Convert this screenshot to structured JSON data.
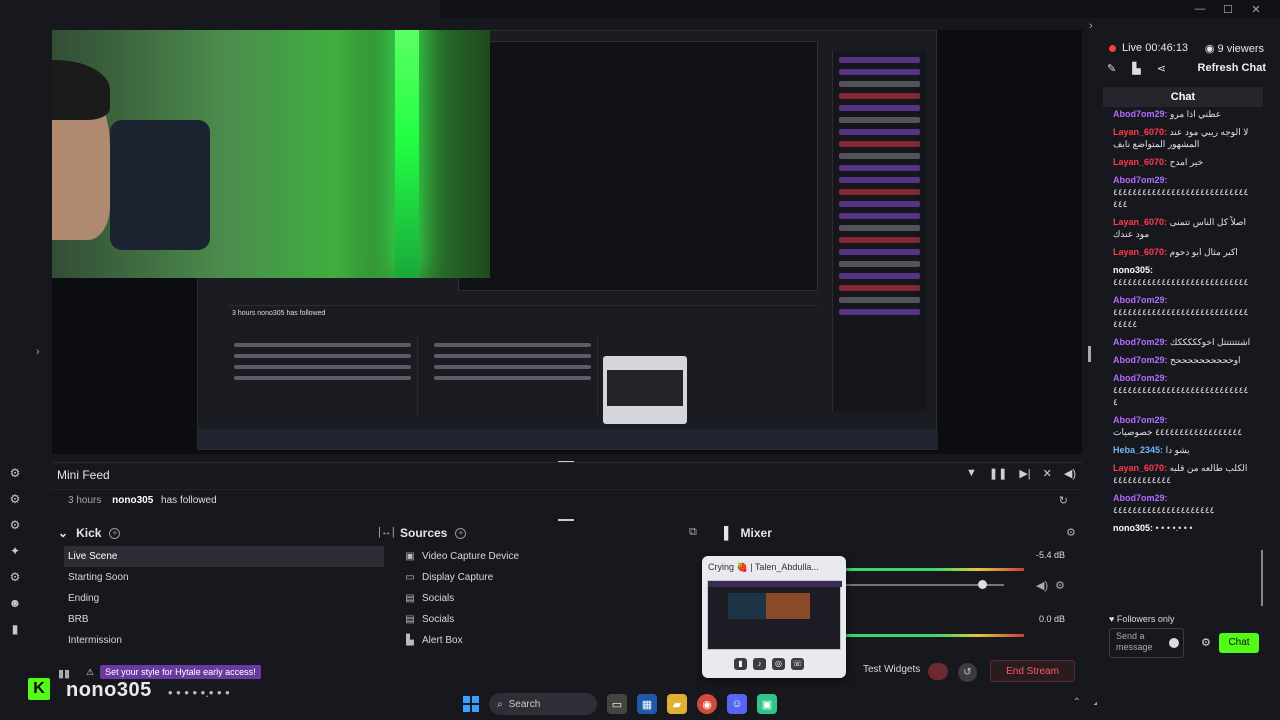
{
  "window": {
    "controls": [
      "—",
      "☐",
      "✕"
    ]
  },
  "preview": {
    "nested_feed_text": "3 hours  nono305  has followed"
  },
  "mini_feed": {
    "title": "Mini Feed",
    "entry": {
      "time": "3 hours",
      "user": "nono305",
      "action": "has followed"
    }
  },
  "scenes": {
    "title": "Kick",
    "items": [
      "Live Scene",
      "Starting Soon",
      "Ending",
      "BRB",
      "Intermission"
    ]
  },
  "sources": {
    "title": "Sources",
    "items": [
      {
        "label": "Video Capture Device",
        "icon": "camera-icon"
      },
      {
        "label": "Display Capture",
        "icon": "monitor-icon"
      },
      {
        "label": "Socials",
        "icon": "layers-icon"
      },
      {
        "label": "Socials",
        "icon": "layers-icon"
      },
      {
        "label": "Alert Box",
        "icon": "alert-icon"
      }
    ]
  },
  "mixer": {
    "title": "Mixer",
    "rows": [
      {
        "db": "-5.4 dB",
        "level": 0.7
      },
      {
        "db": "0.0 dB",
        "level": 1.0
      }
    ]
  },
  "popup": {
    "title": "Crying 🍓 | Talen_Abdulla..."
  },
  "stream": {
    "test_widgets": "Test Widgets",
    "end_stream": "End Stream"
  },
  "overlay": {
    "alert_text": "Set your style for Hytale early access!",
    "name": "nono305",
    "suffix": "• • • • •.• • •"
  },
  "taskbar": {
    "search_placeholder": "Search"
  },
  "chat": {
    "live": "Live 00:46:13",
    "viewers": "9 viewers",
    "refresh": "Refresh Chat",
    "title": "Chat",
    "messages": [
      {
        "user": "Abod7om29:",
        "text": " عطني اذا مرو",
        "color": "#b36cff"
      },
      {
        "user": "Layan_6070:",
        "text": " لا الوجه ريبي مود عند المشهور المتواضع نايف",
        "color": "#ff3b4b"
      },
      {
        "user": "Layan_6070:",
        "text": " خير امدح",
        "color": "#ff3b4b"
      },
      {
        "user": "Abod7om29:",
        "text": " ٤٤٤٤٤٤٤٤٤٤٤٤٤٤٤٤٤٤٤٤٤٤٤٤٤٤٤٤٤٤٤",
        "color": "#b36cff"
      },
      {
        "user": "Layan_6070:",
        "text": " اصلاً كل الناس تتمنى مود عندك",
        "color": "#ff3b4b"
      },
      {
        "user": "Layan_6070:",
        "text": " اكبر مثال ابو دحوم",
        "color": "#ff3b4b"
      },
      {
        "user": "nono305:",
        "text": " ٤٤٤٤٤٤٤٤٤٤٤٤٤٤٤٤٤٤٤٤٤٤٤٤٤٤٤٤",
        "color": "#ffffff"
      },
      {
        "user": "Abod7om29:",
        "text": " ٤٤٤٤٤٤٤٤٤٤٤٤٤٤٤٤٤٤٤٤٤٤٤٤٤٤٤٤٤٤٤٤٤",
        "color": "#b36cff"
      },
      {
        "user": "Abod7om29:",
        "text": " اشتتتتتتل اخوكككككك",
        "color": "#b36cff"
      },
      {
        "user": "Abod7om29:",
        "text": " اوححححححححححح",
        "color": "#b36cff"
      },
      {
        "user": "Abod7om29:",
        "text": " ٤٤٤٤٤٤٤٤٤٤٤٤٤٤٤٤٤٤٤٤٤٤٤٤٤٤٤٤٤",
        "color": "#b36cff"
      },
      {
        "user": "Abod7om29:",
        "text": " ٤٤٤٤٤٤٤٤٤٤٤٤٤٤٤٤٤٤ خصوصيات",
        "color": "#b36cff"
      },
      {
        "user": "Heba_2345:",
        "text": " يشو دا",
        "color": "#6fb6ff"
      },
      {
        "user": "Layan_6070:",
        "text": " الكلب طالعه من قلبه ٤٤٤٤٤٤٤٤٤٤٤٤",
        "color": "#ff3b4b"
      },
      {
        "user": "Abod7om29:",
        "text": " ٤٤٤٤٤٤٤٤٤٤٤٤٤٤٤٤٤٤٤٤٤",
        "color": "#b36cff"
      },
      {
        "user": "nono305:",
        "text": " • • • •.• • •",
        "color": "#ffffff"
      }
    ],
    "followers_only": "Followers only",
    "input_placeholder": "Send a message",
    "send_label": "Chat"
  }
}
